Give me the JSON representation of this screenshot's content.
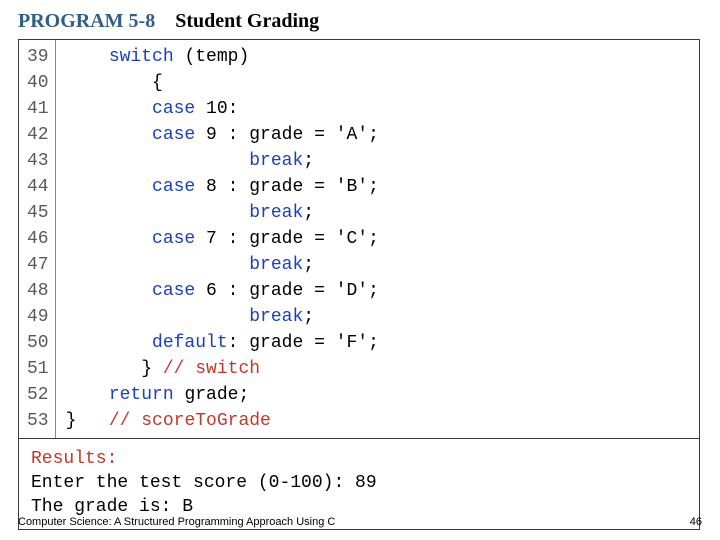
{
  "title": {
    "program_label": "PROGRAM 5-8",
    "program_title": "Student Grading"
  },
  "code": {
    "line_start": 39,
    "line_end": 53,
    "lines": [
      {
        "n": 39,
        "indent": "    ",
        "kw": "switch",
        "rest": " (temp)"
      },
      {
        "n": 40,
        "indent": "        ",
        "rest": "{"
      },
      {
        "n": 41,
        "indent": "        ",
        "kw": "case",
        "rest": " 10:"
      },
      {
        "n": 42,
        "indent": "        ",
        "kw": "case",
        "rest": " 9 : grade = 'A';"
      },
      {
        "n": 43,
        "indent": "                 ",
        "kw": "break",
        "rest": ";"
      },
      {
        "n": 44,
        "indent": "        ",
        "kw": "case",
        "rest": " 8 : grade = 'B';"
      },
      {
        "n": 45,
        "indent": "                 ",
        "kw": "break",
        "rest": ";"
      },
      {
        "n": 46,
        "indent": "        ",
        "kw": "case",
        "rest": " 7 : grade = 'C';"
      },
      {
        "n": 47,
        "indent": "                 ",
        "kw": "break",
        "rest": ";"
      },
      {
        "n": 48,
        "indent": "        ",
        "kw": "case",
        "rest": " 6 : grade = 'D';"
      },
      {
        "n": 49,
        "indent": "                 ",
        "kw": "break",
        "rest": ";"
      },
      {
        "n": 50,
        "indent": "        ",
        "kw": "default",
        "rest": ": grade = 'F';"
      },
      {
        "n": 51,
        "indent": "       ",
        "rest": "} ",
        "cm": "// switch"
      },
      {
        "n": 52,
        "indent": "    ",
        "kw": "return",
        "rest": " grade;"
      },
      {
        "n": 53,
        "indent": "",
        "rest": "}   ",
        "cm": "// scoreToGrade"
      }
    ]
  },
  "results": {
    "label": "Results:",
    "line1": "Enter the test score (0-100): 89",
    "line2": "The grade is: B"
  },
  "footer": {
    "left": "Computer Science: A Structured Programming Approach Using C",
    "right": "46"
  }
}
